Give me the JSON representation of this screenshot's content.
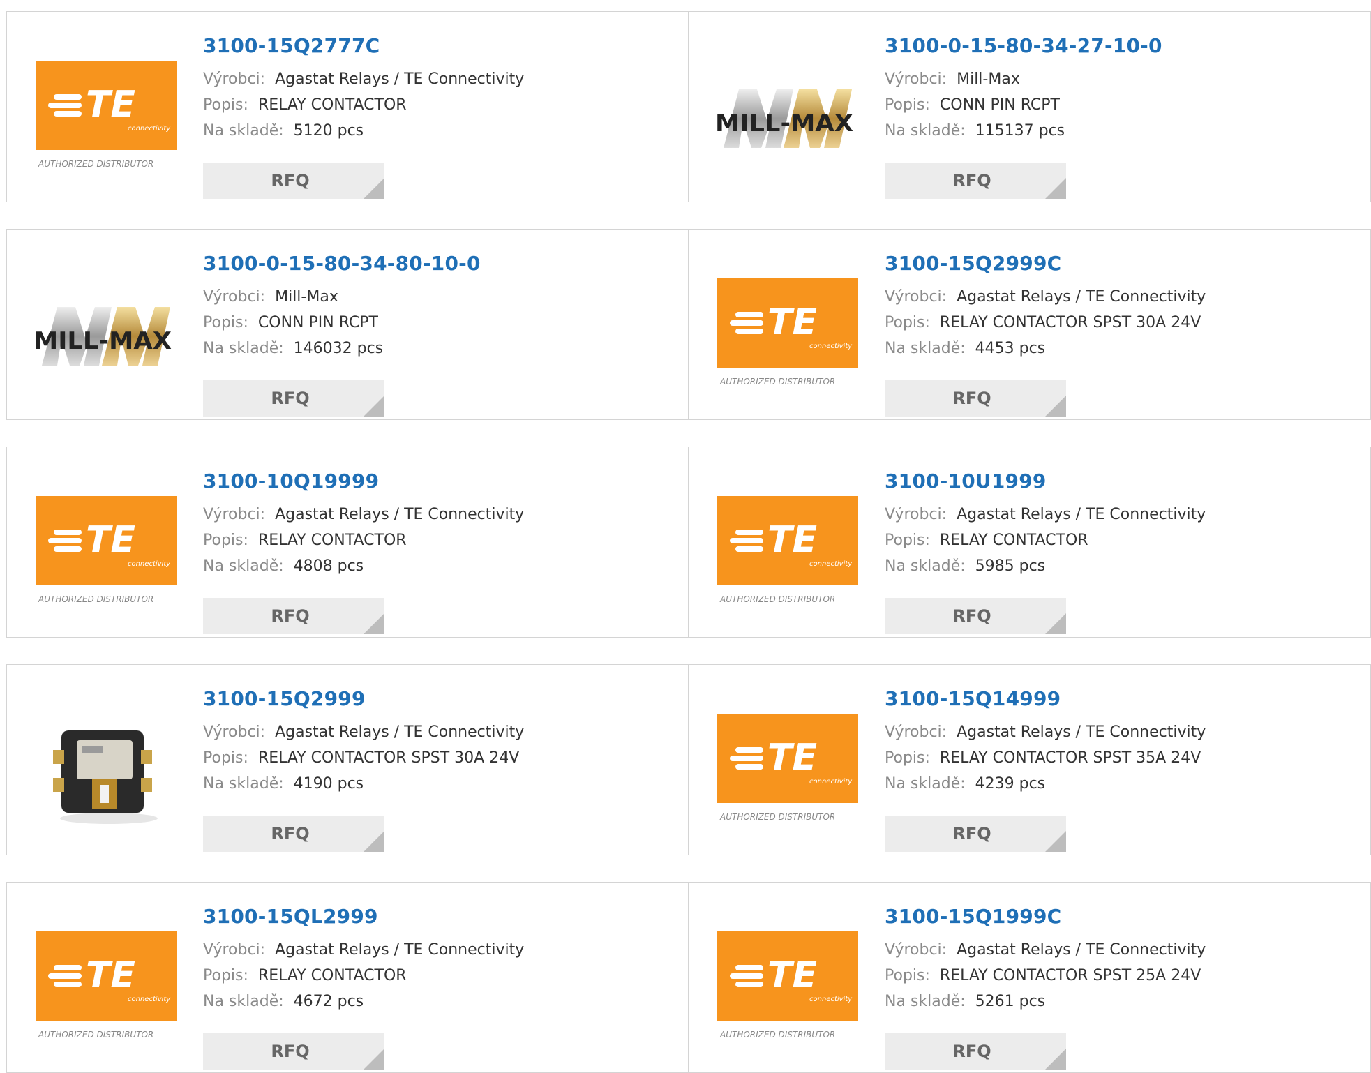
{
  "labels": {
    "manufacturer": "Výrobci:",
    "description": "Popis:",
    "stock": "Na skladě:",
    "rfq": "RFQ"
  },
  "logos": {
    "te_text": "TE",
    "te_sub": "connectivity",
    "te_caption": "AUTHORIZED DISTRIBUTOR",
    "millmax_text": "MILL-MAX"
  },
  "colors": {
    "link": "#1f6fb6",
    "te_orange": "#f7941d",
    "button_bg": "#ececec"
  },
  "products": [
    {
      "part": "3100-15Q2777C",
      "manufacturer": "Agastat Relays / TE Connectivity",
      "description": "RELAY CONTACTOR",
      "stock": "5120 pcs",
      "logo": "te"
    },
    {
      "part": "3100-0-15-80-34-27-10-0",
      "manufacturer": "Mill-Max",
      "description": "CONN PIN RCPT",
      "stock": "115137 pcs",
      "logo": "millmax"
    },
    {
      "part": "3100-0-15-80-34-80-10-0",
      "manufacturer": "Mill-Max",
      "description": "CONN PIN RCPT",
      "stock": "146032 pcs",
      "logo": "millmax"
    },
    {
      "part": "3100-15Q2999C",
      "manufacturer": "Agastat Relays / TE Connectivity",
      "description": "RELAY CONTACTOR SPST 30A 24V",
      "stock": "4453 pcs",
      "logo": "te"
    },
    {
      "part": "3100-10Q19999",
      "manufacturer": "Agastat Relays / TE Connectivity",
      "description": "RELAY CONTACTOR",
      "stock": "4808 pcs",
      "logo": "te"
    },
    {
      "part": "3100-10U1999",
      "manufacturer": "Agastat Relays / TE Connectivity",
      "description": "RELAY CONTACTOR",
      "stock": "5985 pcs",
      "logo": "te"
    },
    {
      "part": "3100-15Q2999",
      "manufacturer": "Agastat Relays / TE Connectivity",
      "description": "RELAY CONTACTOR SPST 30A 24V",
      "stock": "4190 pcs",
      "logo": "photo"
    },
    {
      "part": "3100-15Q14999",
      "manufacturer": "Agastat Relays / TE Connectivity",
      "description": "RELAY CONTACTOR SPST 35A 24V",
      "stock": "4239 pcs",
      "logo": "te"
    },
    {
      "part": "3100-15QL2999",
      "manufacturer": "Agastat Relays / TE Connectivity",
      "description": "RELAY CONTACTOR",
      "stock": "4672 pcs",
      "logo": "te"
    },
    {
      "part": "3100-15Q1999C",
      "manufacturer": "Agastat Relays / TE Connectivity",
      "description": "RELAY CONTACTOR SPST 25A 24V",
      "stock": "5261 pcs",
      "logo": "te"
    }
  ]
}
